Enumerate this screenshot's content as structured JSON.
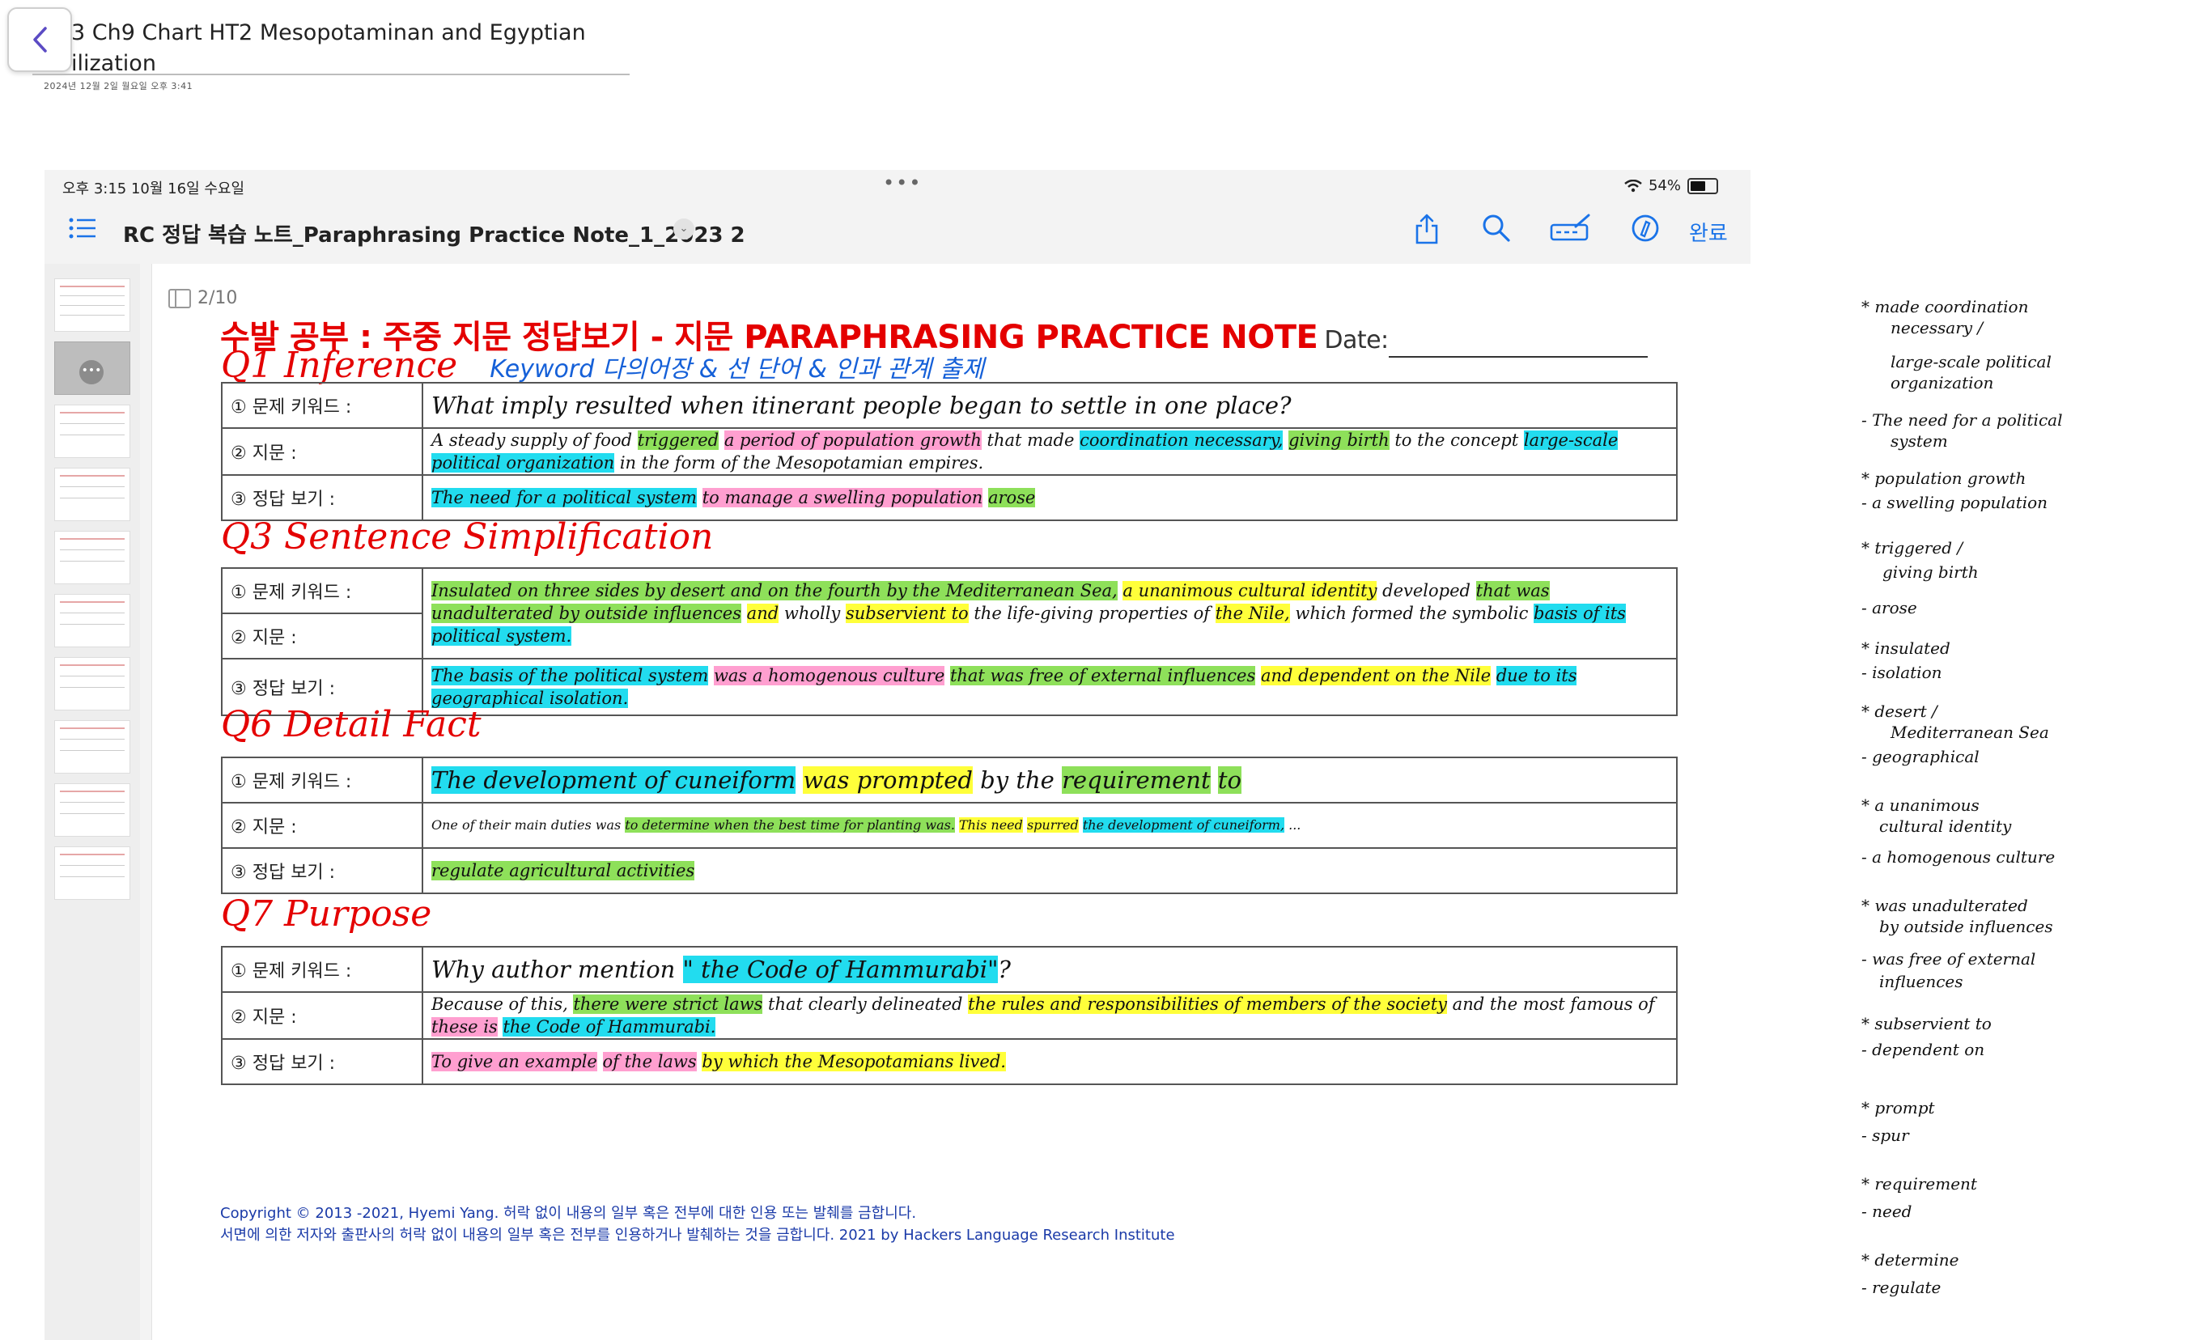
{
  "app": {
    "back_label": "‹",
    "doc_title": "3 Ch9 Chart HT2 Mesopotaminan and Egyptian ilization",
    "doc_date": "2024년 12월 2일 월요일     오후 3:41"
  },
  "screenshot": {
    "status_time": "오후 3:15   10월 16일 수요일",
    "status_dots": "•••",
    "status_battery": "54%",
    "toolbar_title": "RC 정답 복습 노트_Paraphrasing Practice Note_1_2023 2",
    "toolbar_chevron": "⌄",
    "done_label": "완료",
    "page_badge": "2/10",
    "thumb_menu": "•••"
  },
  "page": {
    "headline": "수발 공부 : 주중 지문 정답보기 - 지문 PARAPHRASING PRACTICE NOTE",
    "date_label": "Date:",
    "labels": {
      "keyword": "① 문제 키워드 :",
      "passage": "② 지문 :",
      "answer": "③ 정답 보기 :"
    },
    "q1": {
      "heading": "Q1 Inference",
      "note": "Keyword 다의어장 & 선 단어 & 인과 관계 출제",
      "keyword": "What imply resulted when itinerant people began to settle in one place?",
      "passage": {
        "p1": "A steady supply of food ",
        "h1": "triggered",
        "p2": " ",
        "h2": "a period of population growth",
        "p3": " that made ",
        "h3": "coordination necessary,",
        "p4": " ",
        "h4": "giving birth",
        "p5": " to the concept ",
        "h5": "large-scale political organization",
        "p6": " in the form of the Mesopotamian empires."
      },
      "answer": {
        "h1": "The need for a political system",
        "p1": " ",
        "h2": "to manage a swelling population",
        "p2": " ",
        "h3": "arose"
      }
    },
    "q3": {
      "heading": "Q3 Sentence Simplification",
      "keyword": {
        "h1": "Insulated",
        "h2": " on three sides by desert and on the fourth by the Mediterranean Sea,",
        "p1": " ",
        "h3": "a unanimous cultural identity",
        "p2": " developed ",
        "h4": "that was unadulterated by outside influences",
        "p3": " ",
        "h5": "and",
        "p4": " wholly ",
        "h6": "subservient to",
        "p5": " the life-giving properties of ",
        "h7": "the Nile,",
        "p6": " which formed the symbolic ",
        "h8": "basis of its political system."
      },
      "answer": {
        "h1": "The basis of the political system",
        "p1": " ",
        "h2": "was a homogenous culture",
        "p2": " ",
        "h3": "that was free of external influences",
        "p3": " ",
        "h4": "and dependent on the Nile",
        "p4": " ",
        "h5": "due to its geographical isolation."
      }
    },
    "q6": {
      "heading": "Q6 Detail Fact",
      "keyword": {
        "h1": "The development of cuneiform",
        "p1": " ",
        "h2": "was prompted",
        "p2": " by the ",
        "h3": "requirement",
        "p3": " ",
        "h4": "to"
      },
      "passage": {
        "p1": "One of their main duties was ",
        "h1": "to determine when the best time for planting was.",
        "p2": " ",
        "h2": "This need",
        "p3": " ",
        "h3": "spurred",
        "p4": " ",
        "h4": "the development of cuneiform,",
        "p5": " ..."
      },
      "answer": {
        "h1": "regulate agricultural activities"
      }
    },
    "q7": {
      "heading": "Q7 Purpose",
      "keyword": {
        "p1": "Why author mention ",
        "h1": "\" the Code of Hammurabi\"",
        "p2": "?"
      },
      "passage": {
        "p1": "Because of this, ",
        "h1": "there were strict laws",
        "p2": " that clearly delineated ",
        "h2": "the rules and responsibilities of members of the society",
        "p3": " and the most famous of ",
        "h3": "these is",
        "p4": " ",
        "h4": "the Code of Hammurabi."
      },
      "answer": {
        "h1": "To give an example",
        "p1": " ",
        "h2": "of the laws",
        "p2": " ",
        "h3": "by which the Mesopotamians lived."
      }
    },
    "copyright_1": "Copyright © 2013 -2021, Hyemi Yang. 허락 없이 내용의 일부 혹은 전부에 대한 인용 또는 발췌를 금합니다.",
    "copyright_2": "서면에 의한 저자와 출판사의 허락 없이 내용의 일부 혹은 전부를 인용하거나 발췌하는 것을 금합니다. 2021 by Hackers Language Research Institute"
  },
  "notes": [
    "* made coordination",
    "necessary /",
    "large-scale political",
    "organization",
    "- The need for a political",
    "system",
    "* population growth",
    "- a swelling population",
    "* triggered /",
    "giving birth",
    "- arose",
    "* insulated",
    "- isolation",
    "* desert /",
    "Mediterranean Sea",
    "- geographical",
    "* a unanimous",
    "cultural identity",
    "- a homogenous culture",
    "* was unadulterated",
    "by outside influences",
    "- was free of external",
    "influences",
    "* subservient to",
    "- dependent on",
    "* prompt",
    "- spur",
    "* requirement",
    "- need",
    "* determine",
    "- regulate"
  ],
  "colors": {
    "highlight_cyan": "#22dcef",
    "highlight_pink": "#ff9fd0",
    "highlight_yellow": "#ffff3a",
    "highlight_green": "#8ee05a",
    "heading_red": "#e40000",
    "link_blue": "#1a73e8"
  },
  "icons": [
    "chevron-left-icon",
    "list-icon",
    "share-icon",
    "search-icon",
    "pen-tool-icon",
    "markup-icon",
    "wifi-icon",
    "battery-icon",
    "sidebar-icon"
  ]
}
